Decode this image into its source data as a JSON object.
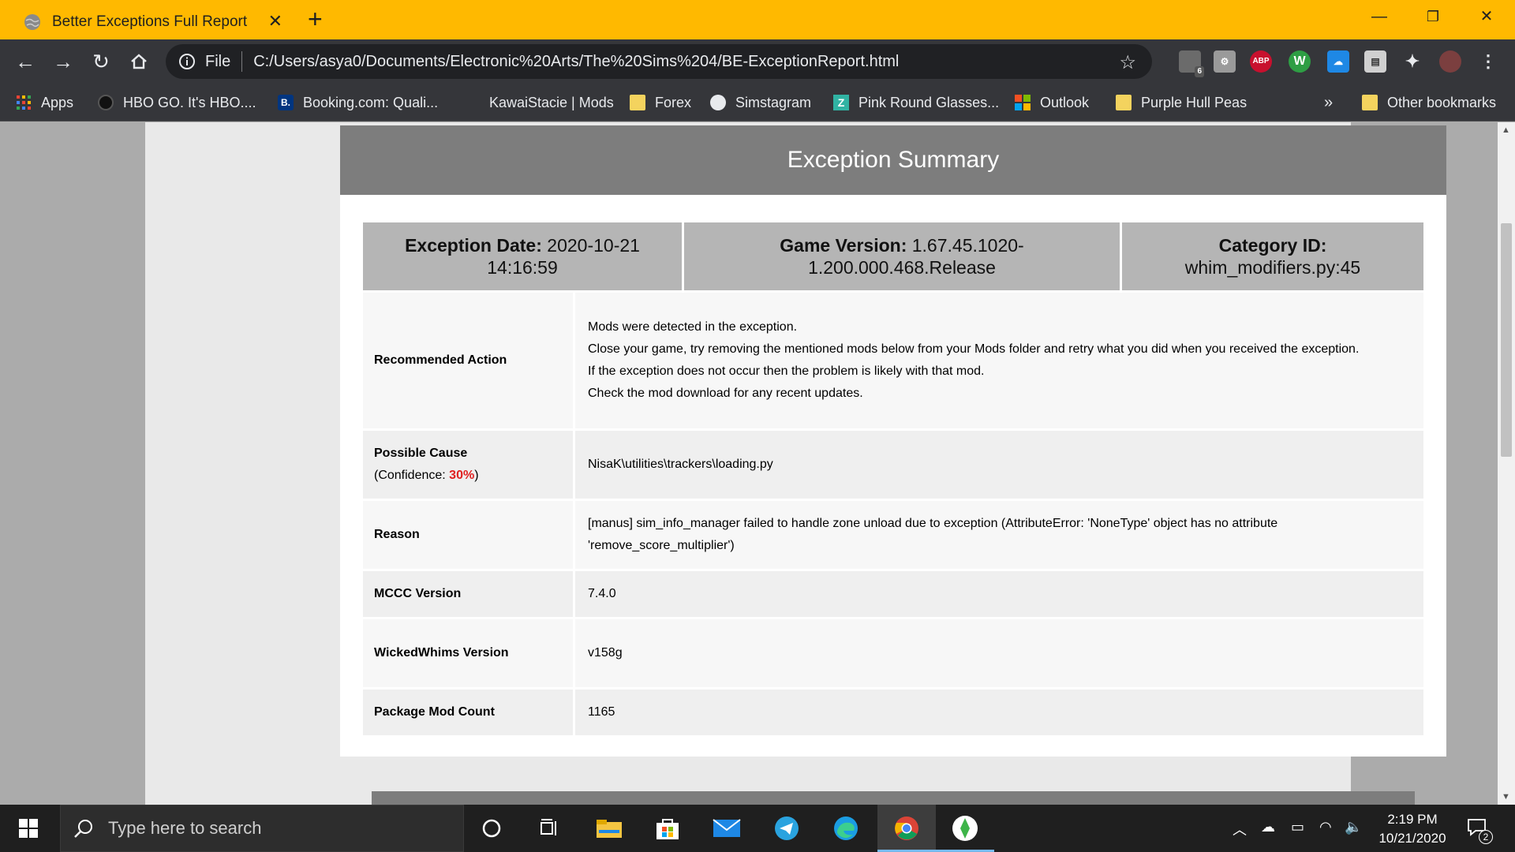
{
  "browser": {
    "tab_title": "Better Exceptions Full Report",
    "file_label": "File",
    "url": "C:/Users/asya0/Documents/Electronic%20Arts/The%20Sims%204/BE-ExceptionReport.html",
    "extension_badge": "6",
    "abp_label": "ABP",
    "w_label": "W"
  },
  "bookmarks": {
    "apps": "Apps",
    "items": [
      "HBO GO. It's HBO....",
      "Booking.com: Quali...",
      "KawaiStacie | Mods",
      "Forex",
      "Simstagram",
      "Pink Round Glasses...",
      "Outlook",
      "Purple Hull Peas"
    ],
    "overflow": "»",
    "other": "Other bookmarks",
    "booking_letter": "B."
  },
  "report": {
    "title": "Exception Summary",
    "date_label": "Exception Date:",
    "date_value": "2020-10-21 14:16:59",
    "version_label": "Game Version:",
    "version_value": "1.67.45.1020-1.200.000.468.Release",
    "category_label": "Category ID:",
    "category_value": "whim_modifiers.py:45",
    "rows": {
      "recommended_label": "Recommended Action",
      "recommended_lines": [
        "Mods were detected in the exception.",
        "Close your game, try removing the mentioned mods below from your Mods folder and retry what you did when you received the exception.",
        "If the exception does not occur then the problem is likely with that mod.",
        "Check the mod download for any recent updates."
      ],
      "cause_label": "Possible Cause",
      "cause_conf_prefix": "(Confidence: ",
      "cause_conf_value": "30%",
      "cause_conf_suffix": ")",
      "cause_value": "NisaK\\utilities\\trackers\\loading.py",
      "reason_label": "Reason",
      "reason_value": "[manus] sim_info_manager failed to handle zone unload due to exception (AttributeError: 'NoneType' object has no attribute 'remove_score_multiplier')",
      "mccc_label": "MCCC Version",
      "mccc_value": "7.4.0",
      "ww_label": "WickedWhims Version",
      "ww_value": "v158g",
      "pkg_label": "Package Mod Count",
      "pkg_value": "1165"
    }
  },
  "taskbar": {
    "search_placeholder": "Type here to search",
    "time": "2:19 PM",
    "date": "10/21/2020",
    "notification_count": "2"
  },
  "colors": {
    "title_bar": "#ffb900",
    "toolbar": "#35363a",
    "header_gray": "#7d7d7d",
    "cell_gray": "#b5b5b5",
    "confidence_red": "#e02020"
  }
}
